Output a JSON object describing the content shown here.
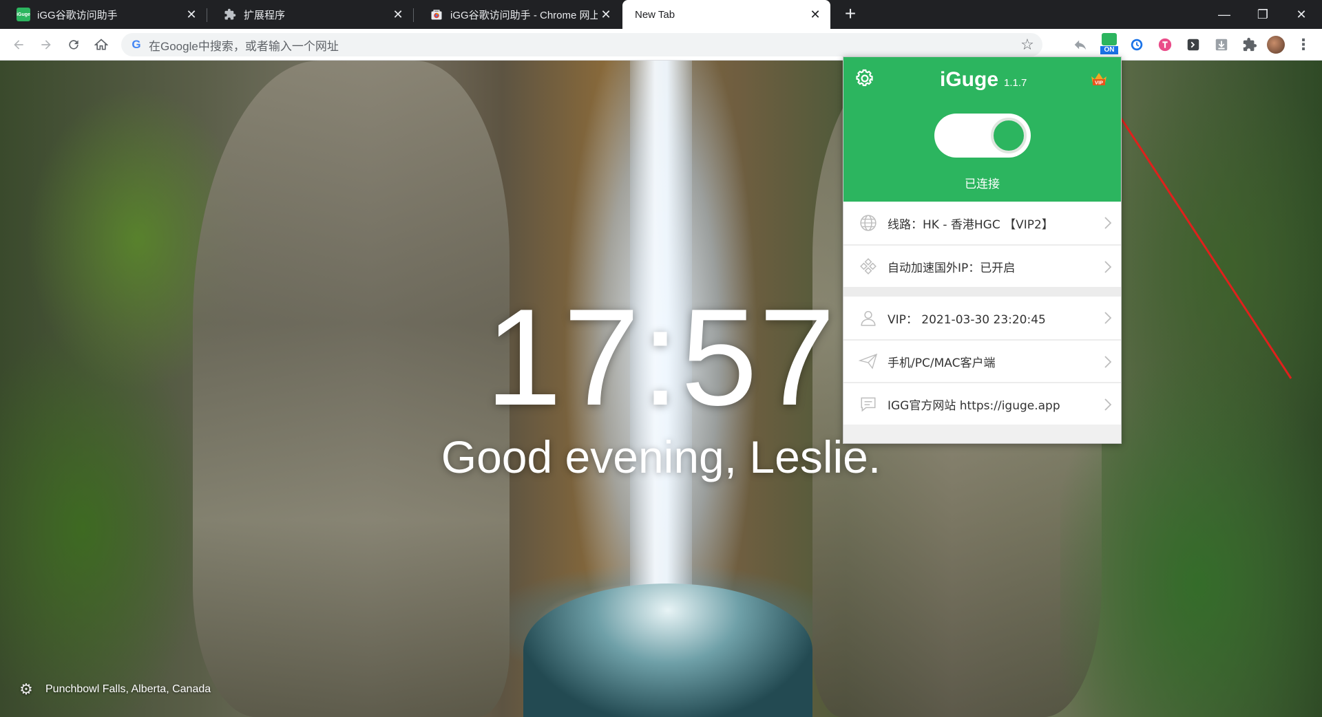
{
  "tabs": [
    {
      "title": "iGG谷歌访问助手",
      "favicon": "igg-icon"
    },
    {
      "title": "扩展程序",
      "favicon": "puzzle-icon"
    },
    {
      "title": "iGG谷歌访问助手 - Chrome 网上",
      "favicon": "chrome-store-icon"
    },
    {
      "title": "New Tab",
      "favicon": ""
    }
  ],
  "tab_favicon_text": "iGuge",
  "window_controls": {
    "minimize": "—",
    "restore": "❐",
    "close": "✕"
  },
  "toolbar": {
    "omnibox_placeholder": "在Google中搜索，或者输入一个网址",
    "ext_on_badge": "ON"
  },
  "newtab": {
    "time": "17:57",
    "greeting": "Good evening, Leslie.",
    "photo_credit": "Punchbowl Falls, Alberta, Canada"
  },
  "popup": {
    "brand": "iGuge",
    "version": "1.1.7",
    "vip_badge": "VIP",
    "status": "已连接",
    "toggle_on": true,
    "items": [
      {
        "label": "线路：HK - 香港HGC 【VIP2】",
        "icon": "globe-icon"
      },
      {
        "label": "自动加速国外IP：已开启",
        "icon": "diamond-icon"
      },
      {
        "label": "VIP： 2021-03-30 23:20:45",
        "icon": "user-icon"
      },
      {
        "label": "手机/PC/MAC客户端",
        "icon": "send-icon"
      },
      {
        "label": "IGG官方网站 https://iguge.app",
        "icon": "chat-icon"
      }
    ]
  },
  "colors": {
    "popup_green": "#2cb55f",
    "tabbar": "#202124",
    "arrow": "#e0201c"
  }
}
